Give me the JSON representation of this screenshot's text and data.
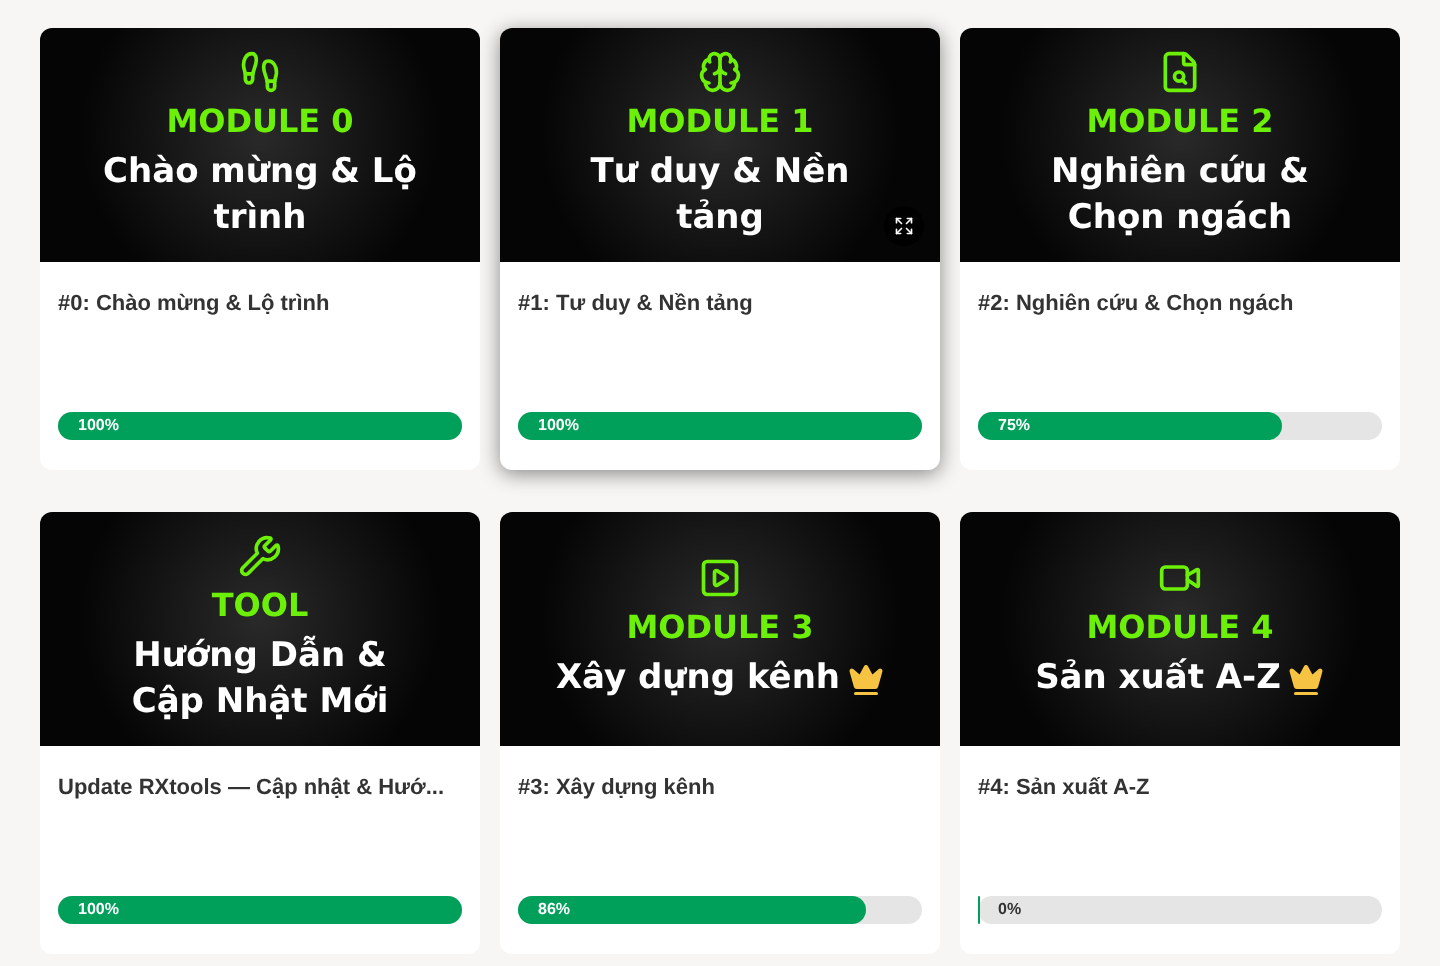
{
  "cards": [
    {
      "tag": "MODULE 0",
      "heading": "Chào mừng & Lộ trình",
      "crown": false,
      "highlighted": false,
      "title": "#0: Chào mừng & Lộ trình",
      "level": 1,
      "reading": "100%"
    },
    {
      "tag": "MODULE 1",
      "heading": "Tư duy & Nền tảng",
      "crown": false,
      "highlighted": true,
      "title": "#1: Tư duy & Nền tảng",
      "level": 1,
      "reading": "100%"
    },
    {
      "tag": "MODULE 2",
      "heading": "Nghiên cứu & Chọn ngách",
      "crown": false,
      "highlighted": false,
      "title": "#2: Nghiên cứu & Chọn ngách",
      "level": 0.75,
      "reading": "75%"
    },
    {
      "tag": "TOOL",
      "heading": "Hướng Dẫn & Cập Nhật Mới",
      "crown": false,
      "highlighted": false,
      "title": "Update RXtools — Cập nhật & Hướ...",
      "level": 1,
      "reading": "100%"
    },
    {
      "tag": "MODULE 3",
      "heading": "Xây dựng kênh",
      "crown": true,
      "highlighted": false,
      "title": "#3: Xây dựng kênh",
      "level": 0.86,
      "reading": "86%"
    },
    {
      "tag": "MODULE 4",
      "heading": "Sản xuất A-Z",
      "crown": true,
      "highlighted": false,
      "title": "#4: Sản xuất A-Z",
      "level": 0,
      "reading": "0%"
    }
  ]
}
